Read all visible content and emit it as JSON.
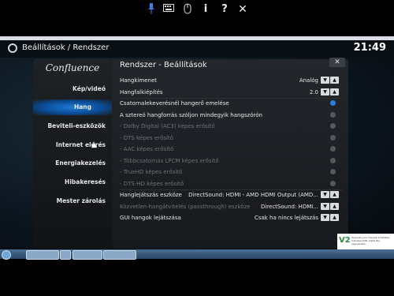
{
  "toolbar": {
    "icons": [
      "pin-icon",
      "keyboard-icon",
      "mouse-icon",
      "info-icon",
      "help-icon",
      "close-icon"
    ],
    "info_glyph": "i",
    "help_glyph": "?",
    "close_glyph": "✕"
  },
  "header": {
    "breadcrumb": "Beállítások  /  Rendszer",
    "clock": "21:49"
  },
  "sidebar": {
    "brand": "Confluence",
    "items": [
      {
        "label": "Kép/videó"
      },
      {
        "label": "Hang"
      },
      {
        "label": "Beviteli-eszközök"
      },
      {
        "label": "Internet elérés"
      },
      {
        "label": "Energiakezelés"
      },
      {
        "label": "Hibakeresés"
      },
      {
        "label": "Mester zárolás"
      }
    ],
    "selected_index": 1
  },
  "panel": {
    "title": "Rendszer - Beállítások",
    "rows": [
      {
        "label": "Hangkimenet",
        "value": "Analóg",
        "control": "arrows",
        "enabled": true
      },
      {
        "label": "Hangfalkiépítés",
        "value": "2.0",
        "control": "arrows",
        "enabled": true
      },
      {
        "label": "Csatornalekeverésnél hangerő emelése",
        "value": "",
        "control": "radio-on",
        "enabled": true
      },
      {
        "label": "A sztereó hangforrás szóljon mindegyik hangszórón",
        "value": "",
        "control": "radio",
        "enabled": true
      },
      {
        "label": "- Dolby Digital (AC3) képes erősítő",
        "value": "",
        "control": "radio",
        "enabled": false
      },
      {
        "label": "- DTS képes erősítő",
        "value": "",
        "control": "radio",
        "enabled": false
      },
      {
        "label": "- AAC képes erősítő",
        "value": "",
        "control": "radio",
        "enabled": false
      },
      {
        "label": "- Többcsatornás LPCM képes erősítő",
        "value": "",
        "control": "radio",
        "enabled": false
      },
      {
        "label": "- TrueHD képes erősítő",
        "value": "",
        "control": "radio",
        "enabled": false
      },
      {
        "label": "- DTS-HD képes erősítő",
        "value": "",
        "control": "radio",
        "enabled": false
      },
      {
        "label": "Hanglejátszás eszköze",
        "value": "DirectSound: HDMI - AMD HDMI Output (AMD...",
        "control": "arrows",
        "enabled": true
      },
      {
        "label": "Közvetlen-hangátvitelés (passthrough) eszköze",
        "value": "DirectSound: HDMI...",
        "control": "arrows",
        "enabled": false
      },
      {
        "label": "GUI hangok lejátszása",
        "value": "Csak ha nincs lejátszás",
        "control": "arrows",
        "enabled": true
      }
    ]
  },
  "notification": {
    "logo": "V2",
    "text": "Upgrade your free Jet d-Installer. Includes DVD. Instal the appropriate..."
  }
}
